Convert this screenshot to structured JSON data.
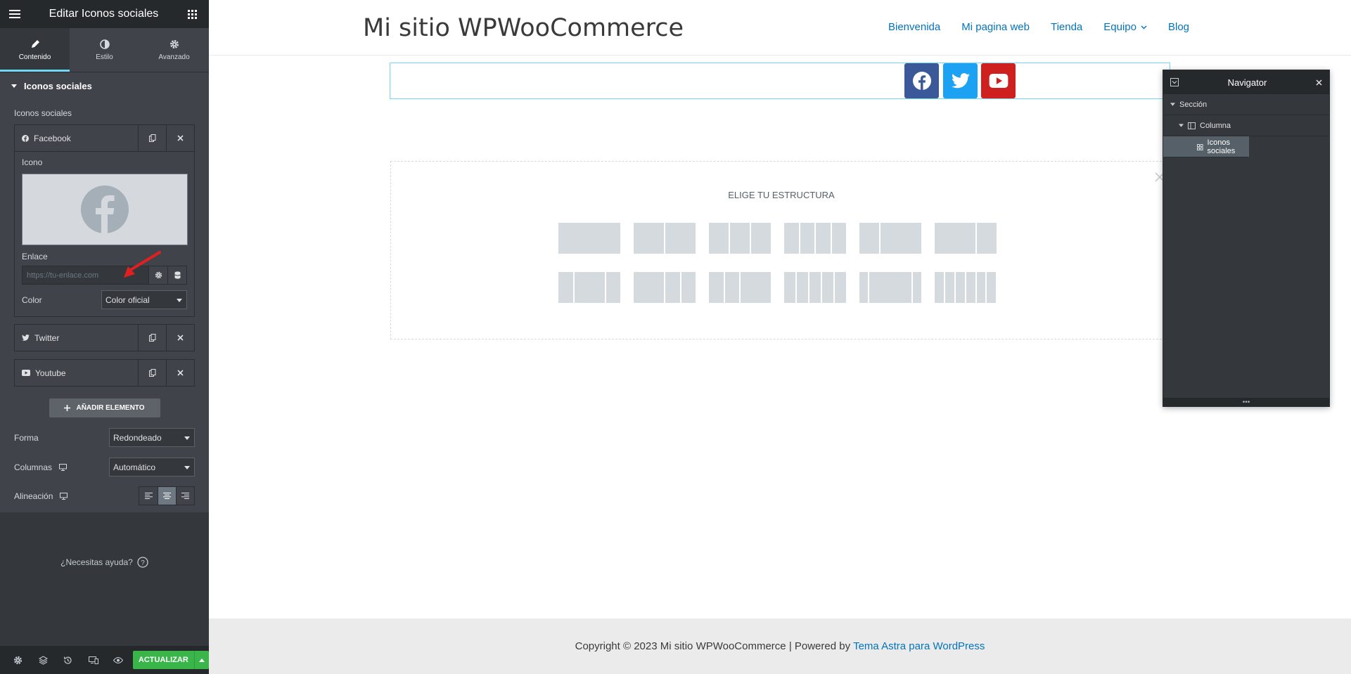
{
  "panel": {
    "title": "Editar Iconos sociales",
    "tabs": [
      {
        "label": "Contenido",
        "icon": "pencil-icon"
      },
      {
        "label": "Estilo",
        "icon": "contrast-icon"
      },
      {
        "label": "Avanzado",
        "icon": "gear-icon"
      }
    ],
    "section_title": "Iconos sociales",
    "repeater_label": "Iconos sociales",
    "items": [
      {
        "label": "Facebook",
        "icon": "facebook-icon"
      },
      {
        "label": "Twitter",
        "icon": "twitter-icon"
      },
      {
        "label": "Youtube",
        "icon": "youtube-icon"
      }
    ],
    "icon_label": "Icono",
    "link_label": "Enlace",
    "link_placeholder": "https://tu-enlace.com",
    "link_value": "",
    "color_label": "Color",
    "color_value": "Color oficial",
    "add_button": "AÑADIR ELEMENTO",
    "shape_label": "Forma",
    "shape_value": "Redondeado",
    "columns_label": "Columnas",
    "columns_value": "Automático",
    "alignment_label": "Alineación",
    "alignment_selected": "center",
    "help_text": "¿Necesitas ayuda?",
    "update_button": "ACTUALIZAR"
  },
  "site": {
    "title": "Mi sitio WPWooCommerce",
    "nav": [
      "Bienvenida",
      "Mi pagina web",
      "Tienda",
      "Equipo",
      "Blog"
    ],
    "social_icons": [
      {
        "name": "facebook",
        "color": "#3b5998"
      },
      {
        "name": "twitter",
        "color": "#1da1f2"
      },
      {
        "name": "youtube",
        "color": "#cd201f"
      }
    ],
    "structure_title": "ELIGE TU ESTRUCTURA",
    "footer_text": "Copyright © 2023 Mi sitio WPWooCommerce | Powered by",
    "footer_link": "Tema Astra para WordPress"
  },
  "navigator": {
    "title": "Navigator",
    "items": [
      {
        "label": "Sección",
        "level": 0
      },
      {
        "label": "Columna",
        "level": 1
      },
      {
        "label": "Iconos sociales",
        "level": 2,
        "selected": true
      }
    ]
  },
  "colors": {
    "panel_bg": "#34383c",
    "accent": "#71d7f7",
    "update_green": "#39b54a",
    "link_blue": "#0274be"
  }
}
